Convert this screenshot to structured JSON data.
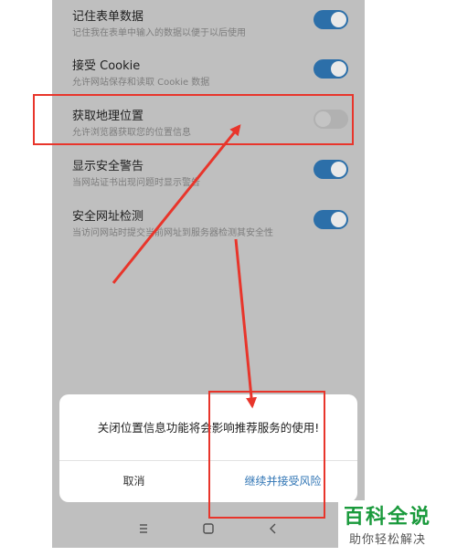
{
  "settings": [
    {
      "title": "记住表单数据",
      "subtitle": "记住我在表单中输入的数据以便于以后使用",
      "enabled": true
    },
    {
      "title": "接受 Cookie",
      "subtitle": "允许网站保存和读取 Cookie 数据",
      "enabled": true
    },
    {
      "title": "获取地理位置",
      "subtitle": "允许浏览器获取您的位置信息",
      "enabled": false
    },
    {
      "title": "显示安全警告",
      "subtitle": "当网站证书出现问题时显示警告",
      "enabled": true
    },
    {
      "title": "安全网址检测",
      "subtitle": "当访问网站时提交当前网址到服务器检测其安全性",
      "enabled": true
    }
  ],
  "dialog": {
    "message": "关闭位置信息功能将会影响推荐服务的使用!",
    "cancel_label": "取消",
    "continue_label": "继续并接受风险"
  },
  "navbar": {
    "icons": [
      "menu-icon",
      "home-icon",
      "back-icon"
    ]
  },
  "watermark": {
    "title": "百科全说",
    "subtitle": "助你轻松解决"
  },
  "colors": {
    "toggle_on": "#2c6fa9",
    "toggle_off": "#b1b1b1",
    "annotation": "#e8352b",
    "link": "#2f74b4",
    "watermark": "#1a9a3c"
  }
}
